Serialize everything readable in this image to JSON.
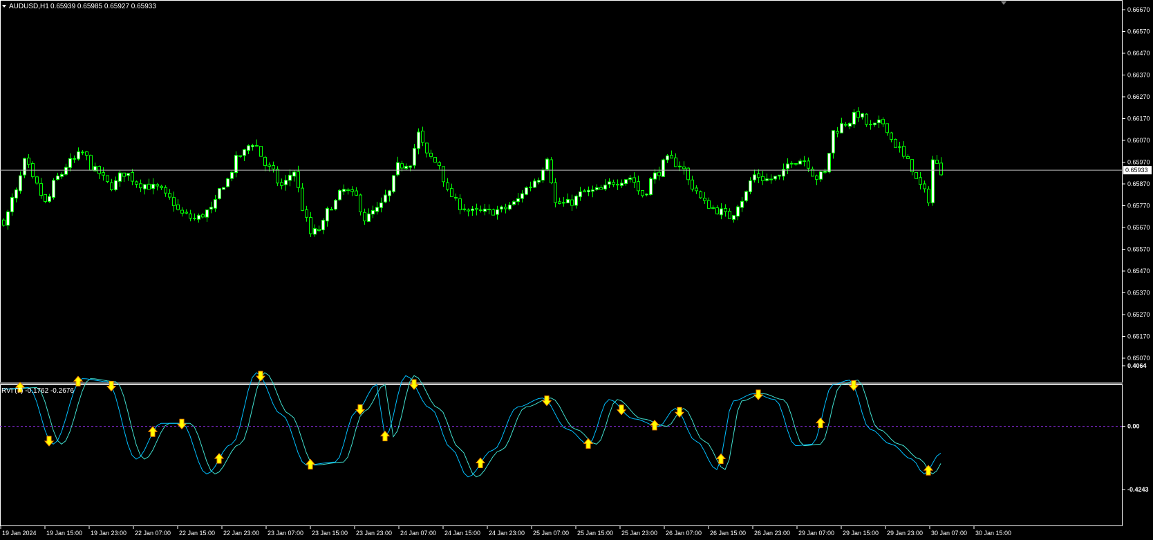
{
  "window": {
    "header": "AUDUSD,H1",
    "ohlc": "0.65939 0.65985 0.65927 0.65933"
  },
  "indicator": {
    "header": "RVI (7) -0.1762 -0.2676"
  },
  "colors": {
    "background": "#000000",
    "candle": "#00ff00",
    "bull_body": "#ffffff",
    "axis_line": "#ffffff",
    "rvi_main": "#00bfff",
    "rvi_signal": "#40e0d0",
    "zero_line": "#8a2be2",
    "arrow_fill": "#ffff00",
    "arrow_stroke": "#ff8c00"
  },
  "price_axis": {
    "labels": [
      "0.66670",
      "0.66570",
      "0.66470",
      "0.66370",
      "0.66270",
      "0.66170",
      "0.66070",
      "0.65970",
      "0.65870",
      "0.65770",
      "0.65670",
      "0.65570",
      "0.65470",
      "0.65370",
      "0.65270",
      "0.65170",
      "0.65070"
    ],
    "current_price": "0.65933"
  },
  "rvi_axis": {
    "labels": [
      "0.4064",
      "0.00",
      "-0.4243"
    ]
  },
  "time_axis": {
    "labels": [
      "19 Jan 2024",
      "19 Jan 15:00",
      "19 Jan 23:00",
      "22 Jan 07:00",
      "22 Jan 15:00",
      "22 Jan 23:00",
      "23 Jan 07:00",
      "23 Jan 15:00",
      "23 Jan 23:00",
      "24 Jan 07:00",
      "24 Jan 15:00",
      "24 Jan 23:00",
      "25 Jan 07:00",
      "25 Jan 15:00",
      "25 Jan 23:00",
      "26 Jan 07:00",
      "26 Jan 15:00",
      "26 Jan 23:00",
      "29 Jan 07:00",
      "29 Jan 15:00",
      "29 Jan 23:00",
      "30 Jan 07:00",
      "30 Jan 15:00"
    ]
  },
  "chart_data": [
    {
      "type": "candlestick",
      "symbol": "AUDUSD",
      "timeframe": "H1",
      "ylim": [
        0.6507,
        0.6667
      ],
      "current": 0.65933,
      "waypoints": [
        [
          0,
          0.657
        ],
        [
          3,
          0.6583
        ],
        [
          5,
          0.6597
        ],
        [
          8,
          0.6586
        ],
        [
          10,
          0.6578
        ],
        [
          13,
          0.659
        ],
        [
          16,
          0.6597
        ],
        [
          19,
          0.6601
        ],
        [
          22,
          0.6593
        ],
        [
          26,
          0.6586
        ],
        [
          29,
          0.6592
        ],
        [
          33,
          0.6587
        ],
        [
          37,
          0.6585
        ],
        [
          40,
          0.658
        ],
        [
          43,
          0.6573
        ],
        [
          46,
          0.6571
        ],
        [
          50,
          0.6575
        ],
        [
          53,
          0.6587
        ],
        [
          57,
          0.66
        ],
        [
          60,
          0.6606
        ],
        [
          64,
          0.6594
        ],
        [
          67,
          0.6586
        ],
        [
          70,
          0.6593
        ],
        [
          72,
          0.6576
        ],
        [
          74,
          0.6564
        ],
        [
          76,
          0.6566
        ],
        [
          79,
          0.6577
        ],
        [
          82,
          0.6584
        ],
        [
          85,
          0.6581
        ],
        [
          87,
          0.6571
        ],
        [
          90,
          0.6575
        ],
        [
          93,
          0.6583
        ],
        [
          95,
          0.6595
        ],
        [
          98,
          0.6597
        ],
        [
          100,
          0.661
        ],
        [
          102,
          0.66
        ],
        [
          105,
          0.6596
        ],
        [
          107,
          0.6583
        ],
        [
          110,
          0.6577
        ],
        [
          113,
          0.6574
        ],
        [
          116,
          0.6574
        ],
        [
          120,
          0.6575
        ],
        [
          123,
          0.6578
        ],
        [
          126,
          0.6585
        ],
        [
          129,
          0.659
        ],
        [
          131,
          0.66
        ],
        [
          133,
          0.6578
        ],
        [
          136,
          0.6578
        ],
        [
          140,
          0.6583
        ],
        [
          144,
          0.6584
        ],
        [
          147,
          0.6588
        ],
        [
          151,
          0.659
        ],
        [
          154,
          0.6582
        ],
        [
          157,
          0.6591
        ],
        [
          160,
          0.6598
        ],
        [
          163,
          0.6596
        ],
        [
          166,
          0.6586
        ],
        [
          169,
          0.6578
        ],
        [
          172,
          0.6575
        ],
        [
          175,
          0.6572
        ],
        [
          178,
          0.658
        ],
        [
          181,
          0.6591
        ],
        [
          184,
          0.6589
        ],
        [
          187,
          0.659
        ],
        [
          190,
          0.6598
        ],
        [
          193,
          0.6598
        ],
        [
          196,
          0.659
        ],
        [
          198,
          0.6592
        ],
        [
          200,
          0.6611
        ],
        [
          203,
          0.6615
        ],
        [
          206,
          0.6619
        ],
        [
          209,
          0.6613
        ],
        [
          212,
          0.6615
        ],
        [
          215,
          0.6605
        ],
        [
          218,
          0.6597
        ],
        [
          221,
          0.6586
        ],
        [
          223,
          0.658
        ],
        [
          224,
          0.6598
        ],
        [
          226,
          0.6593
        ]
      ]
    },
    {
      "type": "line",
      "name": "RVI (7)",
      "ylim": [
        -0.4243,
        0.4064
      ],
      "last_values": [
        -0.1762,
        -0.2676
      ],
      "waypoints": [
        [
          0,
          0.25
        ],
        [
          6,
          0.26
        ],
        [
          12,
          -0.12
        ],
        [
          19,
          0.32
        ],
        [
          25,
          0.3
        ],
        [
          32,
          -0.22
        ],
        [
          38,
          0.02
        ],
        [
          43,
          0.02
        ],
        [
          49,
          -0.32
        ],
        [
          55,
          -0.12
        ],
        [
          61,
          0.36
        ],
        [
          67,
          0.08
        ],
        [
          73,
          -0.26
        ],
        [
          80,
          -0.24
        ],
        [
          85,
          0.1
        ],
        [
          90,
          0.28
        ],
        [
          92,
          -0.07
        ],
        [
          97,
          0.34
        ],
        [
          103,
          0.12
        ],
        [
          108,
          -0.15
        ],
        [
          112,
          -0.34
        ],
        [
          118,
          -0.16
        ],
        [
          124,
          0.13
        ],
        [
          130,
          0.19
        ],
        [
          136,
          -0.02
        ],
        [
          141,
          -0.12
        ],
        [
          146,
          0.18
        ],
        [
          152,
          0.05
        ],
        [
          158,
          0.0
        ],
        [
          162,
          0.12
        ],
        [
          167,
          -0.1
        ],
        [
          172,
          -0.29
        ],
        [
          176,
          0.17
        ],
        [
          181,
          0.22
        ],
        [
          186,
          0.18
        ],
        [
          191,
          -0.13
        ],
        [
          195,
          -0.12
        ],
        [
          200,
          0.28
        ],
        [
          204,
          0.31
        ],
        [
          209,
          -0.02
        ],
        [
          214,
          -0.12
        ],
        [
          219,
          -0.22
        ],
        [
          222,
          -0.32
        ],
        [
          226,
          -0.18
        ]
      ],
      "arrows": [
        {
          "i": 4,
          "d": "up"
        },
        {
          "i": 11,
          "d": "down"
        },
        {
          "i": 18,
          "d": "up"
        },
        {
          "i": 26,
          "d": "down"
        },
        {
          "i": 36,
          "d": "up"
        },
        {
          "i": 43,
          "d": "down"
        },
        {
          "i": 52,
          "d": "up"
        },
        {
          "i": 62,
          "d": "down"
        },
        {
          "i": 74,
          "d": "up"
        },
        {
          "i": 86,
          "d": "down"
        },
        {
          "i": 92,
          "d": "up"
        },
        {
          "i": 99,
          "d": "down"
        },
        {
          "i": 115,
          "d": "up"
        },
        {
          "i": 131,
          "d": "down"
        },
        {
          "i": 141,
          "d": "up"
        },
        {
          "i": 149,
          "d": "down"
        },
        {
          "i": 157,
          "d": "up"
        },
        {
          "i": 163,
          "d": "down"
        },
        {
          "i": 173,
          "d": "up"
        },
        {
          "i": 182,
          "d": "down"
        },
        {
          "i": 197,
          "d": "up"
        },
        {
          "i": 205,
          "d": "down"
        },
        {
          "i": 223,
          "d": "up"
        }
      ]
    }
  ]
}
